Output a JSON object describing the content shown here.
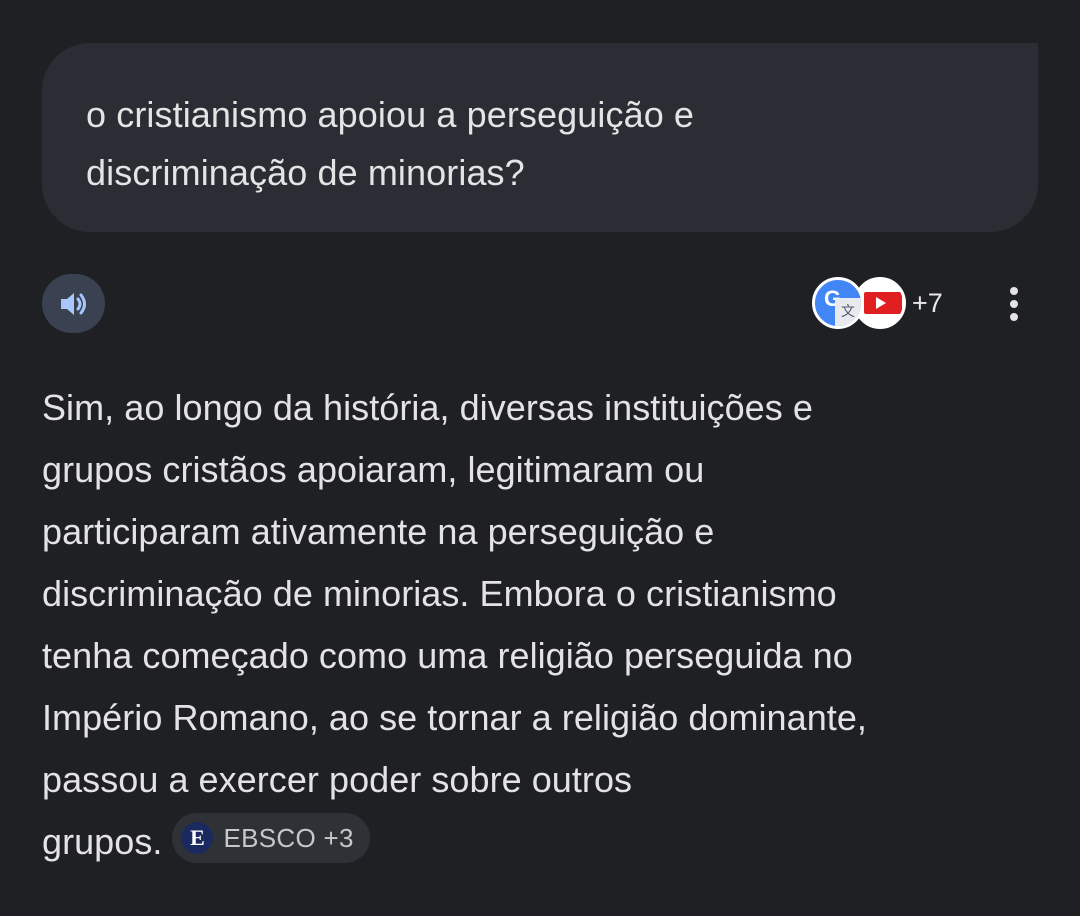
{
  "user_message": {
    "lines": [
      "o cristianismo apoiou a perseguição e",
      "discriminação de minorias?"
    ]
  },
  "response_header": {
    "speaker_icon": "speaker-icon",
    "sources": {
      "icons": [
        "google-translate-icon",
        "youtube-icon"
      ],
      "count_label": "+7"
    },
    "more_icon": "more-vert-icon"
  },
  "answer": {
    "lines": [
      "Sim, ao longo da história, diversas instituições e",
      "grupos cristãos apoiaram, legitimaram ou",
      "participaram ativamente na perseguição e",
      "discriminação de minorias. Embora o cristianismo",
      "tenha começado como uma religião perseguida no",
      "Império Romano, ao se tornar a religião dominante,",
      "passou a exercer poder sobre outros",
      "grupos."
    ],
    "citation_chip": {
      "logo_letter": "E",
      "label": "EBSCO +3"
    }
  },
  "colors": {
    "background": "#1f2023",
    "user_bubble": "#2a2d33",
    "speaker_button": "#3a4150",
    "chip_background": "#2e3136",
    "text": "#e3e3e3"
  }
}
